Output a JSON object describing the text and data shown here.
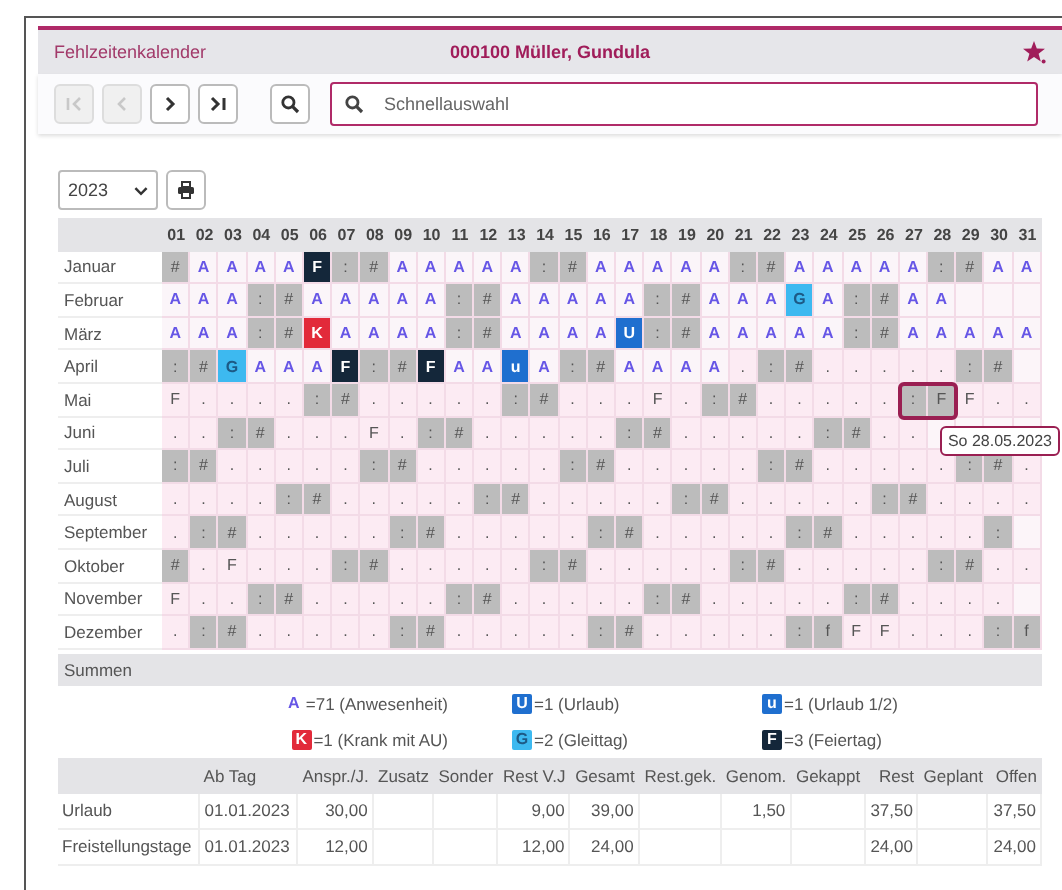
{
  "header": {
    "title": "Fehlzeitenkalender",
    "person": "000100 Müller, Gundula"
  },
  "toolbar": {
    "buttons": [
      {
        "kind": "first",
        "disabled": true
      },
      {
        "kind": "prev",
        "disabled": true
      },
      {
        "kind": "next",
        "disabled": false
      },
      {
        "kind": "last",
        "disabled": false
      },
      {
        "kind": "search",
        "disabled": false
      }
    ],
    "search": {
      "placeholder": "Schnellauswahl"
    }
  },
  "year": "2023",
  "days": [
    "01",
    "02",
    "03",
    "04",
    "05",
    "06",
    "07",
    "08",
    "09",
    "10",
    "11",
    "12",
    "13",
    "14",
    "15",
    "16",
    "17",
    "18",
    "19",
    "20",
    "21",
    "22",
    "23",
    "24",
    "25",
    "26",
    "27",
    "28",
    "29",
    "30",
    "31"
  ],
  "months": [
    {
      "name": "Januar",
      "cells": [
        {
          "text": "#",
          "kind": "weekend"
        },
        {
          "text": "A",
          "kind": "work"
        },
        {
          "text": "A",
          "kind": "work"
        },
        {
          "text": "A",
          "kind": "work"
        },
        {
          "text": "A",
          "kind": "work"
        },
        {
          "text": "F",
          "kind": "holiday"
        },
        {
          "text": ":",
          "kind": "weekend"
        },
        {
          "text": "#",
          "kind": "weekend"
        },
        {
          "text": "A",
          "kind": "work"
        },
        {
          "text": "A",
          "kind": "work"
        },
        {
          "text": "A",
          "kind": "work"
        },
        {
          "text": "A",
          "kind": "work"
        },
        {
          "text": "A",
          "kind": "work"
        },
        {
          "text": ":",
          "kind": "weekend"
        },
        {
          "text": "#",
          "kind": "weekend"
        },
        {
          "text": "A",
          "kind": "work"
        },
        {
          "text": "A",
          "kind": "work"
        },
        {
          "text": "A",
          "kind": "work"
        },
        {
          "text": "A",
          "kind": "work"
        },
        {
          "text": "A",
          "kind": "work"
        },
        {
          "text": ":",
          "kind": "weekend"
        },
        {
          "text": "#",
          "kind": "weekend"
        },
        {
          "text": "A",
          "kind": "work"
        },
        {
          "text": "A",
          "kind": "work"
        },
        {
          "text": "A",
          "kind": "work"
        },
        {
          "text": "A",
          "kind": "work"
        },
        {
          "text": "A",
          "kind": "work"
        },
        {
          "text": ":",
          "kind": "weekend"
        },
        {
          "text": "#",
          "kind": "weekend"
        },
        {
          "text": "A",
          "kind": "work"
        },
        {
          "text": "A",
          "kind": "work"
        }
      ]
    },
    {
      "name": "Februar",
      "cells": [
        {
          "text": "A",
          "kind": "work"
        },
        {
          "text": "A",
          "kind": "work"
        },
        {
          "text": "A",
          "kind": "work"
        },
        {
          "text": ":",
          "kind": "weekend"
        },
        {
          "text": "#",
          "kind": "weekend"
        },
        {
          "text": "A",
          "kind": "work"
        },
        {
          "text": "A",
          "kind": "work"
        },
        {
          "text": "A",
          "kind": "work"
        },
        {
          "text": "A",
          "kind": "work"
        },
        {
          "text": "A",
          "kind": "work"
        },
        {
          "text": ":",
          "kind": "weekend"
        },
        {
          "text": "#",
          "kind": "weekend"
        },
        {
          "text": "A",
          "kind": "work"
        },
        {
          "text": "A",
          "kind": "work"
        },
        {
          "text": "A",
          "kind": "work"
        },
        {
          "text": "A",
          "kind": "work"
        },
        {
          "text": "A",
          "kind": "work"
        },
        {
          "text": ":",
          "kind": "weekend"
        },
        {
          "text": "#",
          "kind": "weekend"
        },
        {
          "text": "A",
          "kind": "work"
        },
        {
          "text": "A",
          "kind": "work"
        },
        {
          "text": "A",
          "kind": "work"
        },
        {
          "text": "G",
          "kind": "flex"
        },
        {
          "text": "A",
          "kind": "work"
        },
        {
          "text": ":",
          "kind": "weekend"
        },
        {
          "text": "#",
          "kind": "weekend"
        },
        {
          "text": "A",
          "kind": "work"
        },
        {
          "text": "A",
          "kind": "work"
        }
      ]
    },
    {
      "name": "März",
      "cells": [
        {
          "text": "A",
          "kind": "work"
        },
        {
          "text": "A",
          "kind": "work"
        },
        {
          "text": "A",
          "kind": "work"
        },
        {
          "text": ":",
          "kind": "weekend"
        },
        {
          "text": "#",
          "kind": "weekend"
        },
        {
          "text": "K",
          "kind": "sick"
        },
        {
          "text": "A",
          "kind": "work"
        },
        {
          "text": "A",
          "kind": "work"
        },
        {
          "text": "A",
          "kind": "work"
        },
        {
          "text": "A",
          "kind": "work"
        },
        {
          "text": ":",
          "kind": "weekend"
        },
        {
          "text": "#",
          "kind": "weekend"
        },
        {
          "text": "A",
          "kind": "work"
        },
        {
          "text": "A",
          "kind": "work"
        },
        {
          "text": "A",
          "kind": "work"
        },
        {
          "text": "A",
          "kind": "work"
        },
        {
          "text": "U",
          "kind": "vacation"
        },
        {
          "text": ":",
          "kind": "weekend"
        },
        {
          "text": "#",
          "kind": "weekend"
        },
        {
          "text": "A",
          "kind": "work"
        },
        {
          "text": "A",
          "kind": "work"
        },
        {
          "text": "A",
          "kind": "work"
        },
        {
          "text": "A",
          "kind": "work"
        },
        {
          "text": "A",
          "kind": "work"
        },
        {
          "text": ":",
          "kind": "weekend"
        },
        {
          "text": "#",
          "kind": "weekend"
        },
        {
          "text": "A",
          "kind": "work"
        },
        {
          "text": "A",
          "kind": "work"
        },
        {
          "text": "A",
          "kind": "work"
        },
        {
          "text": "A",
          "kind": "work"
        },
        {
          "text": "A",
          "kind": "work"
        }
      ]
    },
    {
      "name": "April",
      "cells": [
        {
          "text": ":",
          "kind": "weekend"
        },
        {
          "text": "#",
          "kind": "weekend"
        },
        {
          "text": "G",
          "kind": "flex"
        },
        {
          "text": "A",
          "kind": "work"
        },
        {
          "text": "A",
          "kind": "work"
        },
        {
          "text": "A",
          "kind": "work"
        },
        {
          "text": "F",
          "kind": "holiday"
        },
        {
          "text": ":",
          "kind": "weekend"
        },
        {
          "text": "#",
          "kind": "weekend"
        },
        {
          "text": "F",
          "kind": "holiday"
        },
        {
          "text": "A",
          "kind": "work"
        },
        {
          "text": "A",
          "kind": "work"
        },
        {
          "text": "u",
          "kind": "halfvac"
        },
        {
          "text": "A",
          "kind": "work"
        },
        {
          "text": ":",
          "kind": "weekend"
        },
        {
          "text": "#",
          "kind": "weekend"
        },
        {
          "text": "A",
          "kind": "work"
        },
        {
          "text": "A",
          "kind": "work"
        },
        {
          "text": "A",
          "kind": "work"
        },
        {
          "text": "A",
          "kind": "work"
        },
        {
          "text": ".",
          "kind": "open"
        },
        {
          "text": ":",
          "kind": "weekend"
        },
        {
          "text": "#",
          "kind": "weekend"
        },
        {
          "text": ".",
          "kind": "open"
        },
        {
          "text": ".",
          "kind": "open"
        },
        {
          "text": ".",
          "kind": "open"
        },
        {
          "text": ".",
          "kind": "open"
        },
        {
          "text": ".",
          "kind": "open"
        },
        {
          "text": ":",
          "kind": "weekend"
        },
        {
          "text": "#",
          "kind": "weekend"
        }
      ]
    },
    {
      "name": "Mai",
      "cells": [
        {
          "text": "F",
          "kind": "open"
        },
        {
          "text": ".",
          "kind": "open"
        },
        {
          "text": ".",
          "kind": "open"
        },
        {
          "text": ".",
          "kind": "open"
        },
        {
          "text": ".",
          "kind": "open"
        },
        {
          "text": ":",
          "kind": "weekend"
        },
        {
          "text": "#",
          "kind": "weekend"
        },
        {
          "text": ".",
          "kind": "open"
        },
        {
          "text": ".",
          "kind": "open"
        },
        {
          "text": ".",
          "kind": "open"
        },
        {
          "text": ".",
          "kind": "open"
        },
        {
          "text": ".",
          "kind": "open"
        },
        {
          "text": ":",
          "kind": "weekend"
        },
        {
          "text": "#",
          "kind": "weekend"
        },
        {
          "text": ".",
          "kind": "open"
        },
        {
          "text": ".",
          "kind": "open"
        },
        {
          "text": ".",
          "kind": "open"
        },
        {
          "text": "F",
          "kind": "open"
        },
        {
          "text": ".",
          "kind": "open"
        },
        {
          "text": ":",
          "kind": "weekend"
        },
        {
          "text": "#",
          "kind": "weekend"
        },
        {
          "text": ".",
          "kind": "open"
        },
        {
          "text": ".",
          "kind": "open"
        },
        {
          "text": ".",
          "kind": "open"
        },
        {
          "text": ".",
          "kind": "open"
        },
        {
          "text": ".",
          "kind": "open"
        },
        {
          "text": ":",
          "kind": "weekend",
          "selected": true
        },
        {
          "text": "F",
          "kind": "weekend",
          "selected": true
        },
        {
          "text": "F",
          "kind": "open"
        },
        {
          "text": ".",
          "kind": "open"
        },
        {
          "text": ".",
          "kind": "open"
        }
      ]
    },
    {
      "name": "Juni",
      "cells": [
        {
          "text": ".",
          "kind": "open"
        },
        {
          "text": ".",
          "kind": "open"
        },
        {
          "text": ":",
          "kind": "weekend"
        },
        {
          "text": "#",
          "kind": "weekend"
        },
        {
          "text": ".",
          "kind": "open"
        },
        {
          "text": ".",
          "kind": "open"
        },
        {
          "text": ".",
          "kind": "open"
        },
        {
          "text": "F",
          "kind": "open"
        },
        {
          "text": ".",
          "kind": "open"
        },
        {
          "text": ":",
          "kind": "weekend"
        },
        {
          "text": "#",
          "kind": "weekend"
        },
        {
          "text": ".",
          "kind": "open"
        },
        {
          "text": ".",
          "kind": "open"
        },
        {
          "text": ".",
          "kind": "open"
        },
        {
          "text": ".",
          "kind": "open"
        },
        {
          "text": ".",
          "kind": "open"
        },
        {
          "text": ":",
          "kind": "weekend"
        },
        {
          "text": "#",
          "kind": "weekend"
        },
        {
          "text": ".",
          "kind": "open"
        },
        {
          "text": ".",
          "kind": "open"
        },
        {
          "text": ".",
          "kind": "open"
        },
        {
          "text": ".",
          "kind": "open"
        },
        {
          "text": ".",
          "kind": "open"
        },
        {
          "text": ":",
          "kind": "weekend"
        },
        {
          "text": "#",
          "kind": "weekend"
        },
        {
          "text": ".",
          "kind": "open"
        },
        {
          "text": ".",
          "kind": "open"
        }
      ]
    },
    {
      "name": "Juli",
      "cells": [
        {
          "text": ":",
          "kind": "weekend"
        },
        {
          "text": "#",
          "kind": "weekend"
        },
        {
          "text": ".",
          "kind": "open"
        },
        {
          "text": ".",
          "kind": "open"
        },
        {
          "text": ".",
          "kind": "open"
        },
        {
          "text": ".",
          "kind": "open"
        },
        {
          "text": ".",
          "kind": "open"
        },
        {
          "text": ":",
          "kind": "weekend"
        },
        {
          "text": "#",
          "kind": "weekend"
        },
        {
          "text": ".",
          "kind": "open"
        },
        {
          "text": ".",
          "kind": "open"
        },
        {
          "text": ".",
          "kind": "open"
        },
        {
          "text": ".",
          "kind": "open"
        },
        {
          "text": ".",
          "kind": "open"
        },
        {
          "text": ":",
          "kind": "weekend"
        },
        {
          "text": "#",
          "kind": "weekend"
        },
        {
          "text": ".",
          "kind": "open"
        },
        {
          "text": ".",
          "kind": "open"
        },
        {
          "text": ".",
          "kind": "open"
        },
        {
          "text": ".",
          "kind": "open"
        },
        {
          "text": ".",
          "kind": "open"
        },
        {
          "text": ":",
          "kind": "weekend"
        },
        {
          "text": "#",
          "kind": "weekend"
        },
        {
          "text": ".",
          "kind": "open"
        },
        {
          "text": ".",
          "kind": "open"
        },
        {
          "text": ".",
          "kind": "open"
        },
        {
          "text": ".",
          "kind": "open"
        },
        {
          "text": ".",
          "kind": "open"
        },
        {
          "text": ":",
          "kind": "weekend"
        },
        {
          "text": "#",
          "kind": "weekend"
        },
        {
          "text": ".",
          "kind": "open"
        }
      ]
    },
    {
      "name": "August",
      "cells": [
        {
          "text": ".",
          "kind": "open"
        },
        {
          "text": ".",
          "kind": "open"
        },
        {
          "text": ".",
          "kind": "open"
        },
        {
          "text": ".",
          "kind": "open"
        },
        {
          "text": ":",
          "kind": "weekend"
        },
        {
          "text": "#",
          "kind": "weekend"
        },
        {
          "text": ".",
          "kind": "open"
        },
        {
          "text": ".",
          "kind": "open"
        },
        {
          "text": ".",
          "kind": "open"
        },
        {
          "text": ".",
          "kind": "open"
        },
        {
          "text": ".",
          "kind": "open"
        },
        {
          "text": ":",
          "kind": "weekend"
        },
        {
          "text": "#",
          "kind": "weekend"
        },
        {
          "text": ".",
          "kind": "open"
        },
        {
          "text": ".",
          "kind": "open"
        },
        {
          "text": ".",
          "kind": "open"
        },
        {
          "text": ".",
          "kind": "open"
        },
        {
          "text": ".",
          "kind": "open"
        },
        {
          "text": ":",
          "kind": "weekend"
        },
        {
          "text": "#",
          "kind": "weekend"
        },
        {
          "text": ".",
          "kind": "open"
        },
        {
          "text": ".",
          "kind": "open"
        },
        {
          "text": ".",
          "kind": "open"
        },
        {
          "text": ".",
          "kind": "open"
        },
        {
          "text": ".",
          "kind": "open"
        },
        {
          "text": ":",
          "kind": "weekend"
        },
        {
          "text": "#",
          "kind": "weekend"
        },
        {
          "text": ".",
          "kind": "open"
        },
        {
          "text": ".",
          "kind": "open"
        },
        {
          "text": ".",
          "kind": "open"
        },
        {
          "text": ".",
          "kind": "open"
        }
      ]
    },
    {
      "name": "September",
      "cells": [
        {
          "text": ".",
          "kind": "open"
        },
        {
          "text": ":",
          "kind": "weekend"
        },
        {
          "text": "#",
          "kind": "weekend"
        },
        {
          "text": ".",
          "kind": "open"
        },
        {
          "text": ".",
          "kind": "open"
        },
        {
          "text": ".",
          "kind": "open"
        },
        {
          "text": ".",
          "kind": "open"
        },
        {
          "text": ".",
          "kind": "open"
        },
        {
          "text": ":",
          "kind": "weekend"
        },
        {
          "text": "#",
          "kind": "weekend"
        },
        {
          "text": ".",
          "kind": "open"
        },
        {
          "text": ".",
          "kind": "open"
        },
        {
          "text": ".",
          "kind": "open"
        },
        {
          "text": ".",
          "kind": "open"
        },
        {
          "text": ".",
          "kind": "open"
        },
        {
          "text": ":",
          "kind": "weekend"
        },
        {
          "text": "#",
          "kind": "weekend"
        },
        {
          "text": ".",
          "kind": "open"
        },
        {
          "text": ".",
          "kind": "open"
        },
        {
          "text": ".",
          "kind": "open"
        },
        {
          "text": ".",
          "kind": "open"
        },
        {
          "text": ".",
          "kind": "open"
        },
        {
          "text": ":",
          "kind": "weekend"
        },
        {
          "text": "#",
          "kind": "weekend"
        },
        {
          "text": ".",
          "kind": "open"
        },
        {
          "text": ".",
          "kind": "open"
        },
        {
          "text": ".",
          "kind": "open"
        },
        {
          "text": ".",
          "kind": "open"
        },
        {
          "text": ".",
          "kind": "open"
        },
        {
          "text": ":",
          "kind": "weekend"
        }
      ]
    },
    {
      "name": "Oktober",
      "cells": [
        {
          "text": "#",
          "kind": "weekend"
        },
        {
          "text": ".",
          "kind": "open"
        },
        {
          "text": "F",
          "kind": "open"
        },
        {
          "text": ".",
          "kind": "open"
        },
        {
          "text": ".",
          "kind": "open"
        },
        {
          "text": ".",
          "kind": "open"
        },
        {
          "text": ":",
          "kind": "weekend"
        },
        {
          "text": "#",
          "kind": "weekend"
        },
        {
          "text": ".",
          "kind": "open"
        },
        {
          "text": ".",
          "kind": "open"
        },
        {
          "text": ".",
          "kind": "open"
        },
        {
          "text": ".",
          "kind": "open"
        },
        {
          "text": ".",
          "kind": "open"
        },
        {
          "text": ":",
          "kind": "weekend"
        },
        {
          "text": "#",
          "kind": "weekend"
        },
        {
          "text": ".",
          "kind": "open"
        },
        {
          "text": ".",
          "kind": "open"
        },
        {
          "text": ".",
          "kind": "open"
        },
        {
          "text": ".",
          "kind": "open"
        },
        {
          "text": ".",
          "kind": "open"
        },
        {
          "text": ":",
          "kind": "weekend"
        },
        {
          "text": "#",
          "kind": "weekend"
        },
        {
          "text": ".",
          "kind": "open"
        },
        {
          "text": ".",
          "kind": "open"
        },
        {
          "text": ".",
          "kind": "open"
        },
        {
          "text": ".",
          "kind": "open"
        },
        {
          "text": ".",
          "kind": "open"
        },
        {
          "text": ":",
          "kind": "weekend"
        },
        {
          "text": "#",
          "kind": "weekend"
        },
        {
          "text": ".",
          "kind": "open"
        },
        {
          "text": ".",
          "kind": "open"
        }
      ]
    },
    {
      "name": "November",
      "cells": [
        {
          "text": "F",
          "kind": "open"
        },
        {
          "text": ".",
          "kind": "open"
        },
        {
          "text": ".",
          "kind": "open"
        },
        {
          "text": ":",
          "kind": "weekend"
        },
        {
          "text": "#",
          "kind": "weekend"
        },
        {
          "text": ".",
          "kind": "open"
        },
        {
          "text": ".",
          "kind": "open"
        },
        {
          "text": ".",
          "kind": "open"
        },
        {
          "text": ".",
          "kind": "open"
        },
        {
          "text": ".",
          "kind": "open"
        },
        {
          "text": ":",
          "kind": "weekend"
        },
        {
          "text": "#",
          "kind": "weekend"
        },
        {
          "text": ".",
          "kind": "open"
        },
        {
          "text": ".",
          "kind": "open"
        },
        {
          "text": ".",
          "kind": "open"
        },
        {
          "text": ".",
          "kind": "open"
        },
        {
          "text": ".",
          "kind": "open"
        },
        {
          "text": ":",
          "kind": "weekend"
        },
        {
          "text": "#",
          "kind": "weekend"
        },
        {
          "text": ".",
          "kind": "open"
        },
        {
          "text": ".",
          "kind": "open"
        },
        {
          "text": ".",
          "kind": "open"
        },
        {
          "text": ".",
          "kind": "open"
        },
        {
          "text": ".",
          "kind": "open"
        },
        {
          "text": ":",
          "kind": "weekend"
        },
        {
          "text": "#",
          "kind": "weekend"
        },
        {
          "text": ".",
          "kind": "open"
        },
        {
          "text": ".",
          "kind": "open"
        },
        {
          "text": ".",
          "kind": "open"
        },
        {
          "text": ".",
          "kind": "open"
        }
      ]
    },
    {
      "name": "Dezember",
      "cells": [
        {
          "text": ".",
          "kind": "open"
        },
        {
          "text": ":",
          "kind": "weekend"
        },
        {
          "text": "#",
          "kind": "weekend"
        },
        {
          "text": ".",
          "kind": "open"
        },
        {
          "text": ".",
          "kind": "open"
        },
        {
          "text": ".",
          "kind": "open"
        },
        {
          "text": ".",
          "kind": "open"
        },
        {
          "text": ".",
          "kind": "open"
        },
        {
          "text": ":",
          "kind": "weekend"
        },
        {
          "text": "#",
          "kind": "weekend"
        },
        {
          "text": ".",
          "kind": "open"
        },
        {
          "text": ".",
          "kind": "open"
        },
        {
          "text": ".",
          "kind": "open"
        },
        {
          "text": ".",
          "kind": "open"
        },
        {
          "text": ".",
          "kind": "open"
        },
        {
          "text": ":",
          "kind": "weekend"
        },
        {
          "text": "#",
          "kind": "weekend"
        },
        {
          "text": ".",
          "kind": "open"
        },
        {
          "text": ".",
          "kind": "open"
        },
        {
          "text": ".",
          "kind": "open"
        },
        {
          "text": ".",
          "kind": "open"
        },
        {
          "text": ".",
          "kind": "open"
        },
        {
          "text": ":",
          "kind": "weekend"
        },
        {
          "text": "f",
          "kind": "weekend"
        },
        {
          "text": "F",
          "kind": "open"
        },
        {
          "text": "F",
          "kind": "open"
        },
        {
          "text": ".",
          "kind": "open"
        },
        {
          "text": ".",
          "kind": "open"
        },
        {
          "text": ".",
          "kind": "open"
        },
        {
          "text": ":",
          "kind": "weekend"
        },
        {
          "text": "f",
          "kind": "weekend"
        }
      ]
    }
  ],
  "tooltip": "So 28.05.2023",
  "summary": {
    "title": "Summen",
    "items": [
      {
        "code": "A",
        "kind": "work",
        "text": "=71 (Anwesenheit)"
      },
      {
        "code": "U",
        "kind": "vacation",
        "text": "=1 (Urlaub)"
      },
      {
        "code": "u",
        "kind": "halfvac",
        "text": "=1 (Urlaub 1/2)"
      },
      {
        "code": "K",
        "kind": "sick",
        "text": "=1 (Krank mit AU)"
      },
      {
        "code": "G",
        "kind": "flex",
        "text": "=2 (Gleittag)"
      },
      {
        "code": "F",
        "kind": "holiday",
        "text": "=3 (Feiertag)"
      }
    ]
  },
  "table": {
    "columns": [
      "Ab Tag",
      "Anspr./J.",
      "Zusatz",
      "Sonder",
      "Rest V.J",
      "Gesamt",
      "Rest.gek.",
      "Genom.",
      "Gekappt",
      "Rest",
      "Geplant",
      "Offen"
    ],
    "rows": [
      {
        "label": "Urlaub",
        "cells": [
          "01.01.2023",
          "30,00",
          null,
          null,
          "9,00",
          "39,00",
          null,
          "1,50",
          null,
          "37,50",
          null,
          "37,50"
        ]
      },
      {
        "label": "Freistellungstage",
        "cells": [
          "01.01.2023",
          "12,00",
          null,
          null,
          "12,00",
          "24,00",
          null,
          null,
          null,
          "24,00",
          null,
          "24,00"
        ]
      }
    ]
  }
}
